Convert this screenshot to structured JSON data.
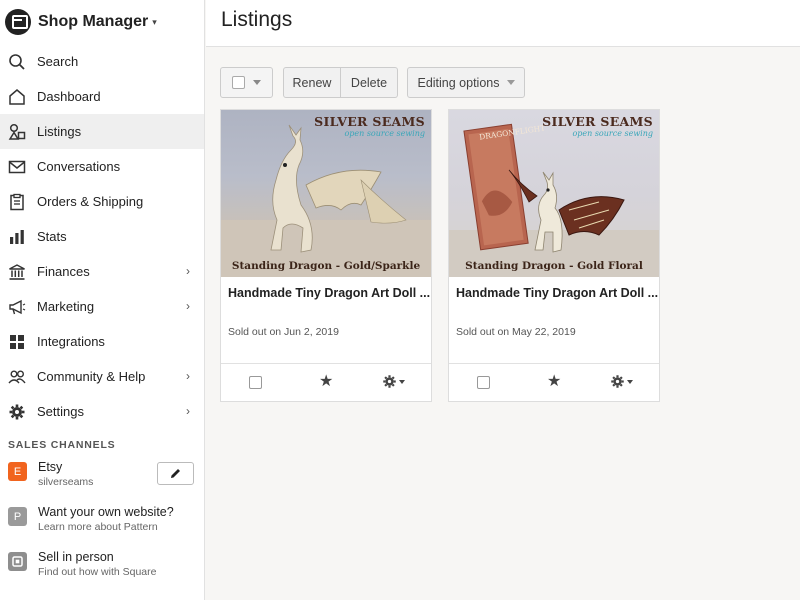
{
  "app": {
    "title": "Shop Manager",
    "caret": "▾"
  },
  "nav": {
    "items": [
      {
        "label": "Search"
      },
      {
        "label": "Dashboard"
      },
      {
        "label": "Listings"
      },
      {
        "label": "Conversations"
      },
      {
        "label": "Orders & Shipping"
      },
      {
        "label": "Stats"
      },
      {
        "label": "Finances"
      },
      {
        "label": "Marketing"
      },
      {
        "label": "Integrations"
      },
      {
        "label": "Community & Help"
      },
      {
        "label": "Settings"
      }
    ],
    "active": "Listings",
    "chevron": "›"
  },
  "sales_channels": {
    "header": "SALES CHANNELS",
    "channels": [
      {
        "badge": "E",
        "title": "Etsy",
        "subtitle": "silverseams",
        "badge_color": "#f1641e"
      },
      {
        "badge": "P",
        "title": "Want your own website?",
        "subtitle": "Learn more about Pattern",
        "badge_color": "#9a9a9a"
      },
      {
        "badge": "",
        "title": "Sell in person",
        "subtitle": "Find out how with Square",
        "badge_color": "#8e8e8e"
      }
    ]
  },
  "page": {
    "title": "Listings"
  },
  "toolbar": {
    "renew_label": "Renew",
    "delete_label": "Delete",
    "editing_label": "Editing options"
  },
  "listings": [
    {
      "brand": "SILVER SEAMS",
      "brand_sub": "open source sewing",
      "caption": "Standing Dragon - Gold/Sparkle",
      "title": "Handmade Tiny Dragon Art Doll ...",
      "status": "Sold out on Jun 2, 2019"
    },
    {
      "brand": "SILVER SEAMS",
      "brand_sub": "open source sewing",
      "book_title": "DRAGONFLIGHT",
      "caption": "Standing Dragon - Gold Floral",
      "title": "Handmade Tiny Dragon Art Doll ...",
      "status": "Sold out on May 22, 2019"
    }
  ],
  "icons": {
    "star": "★"
  },
  "colors": {
    "etsy_orange": "#f1641e",
    "active_bg": "#efefef"
  }
}
